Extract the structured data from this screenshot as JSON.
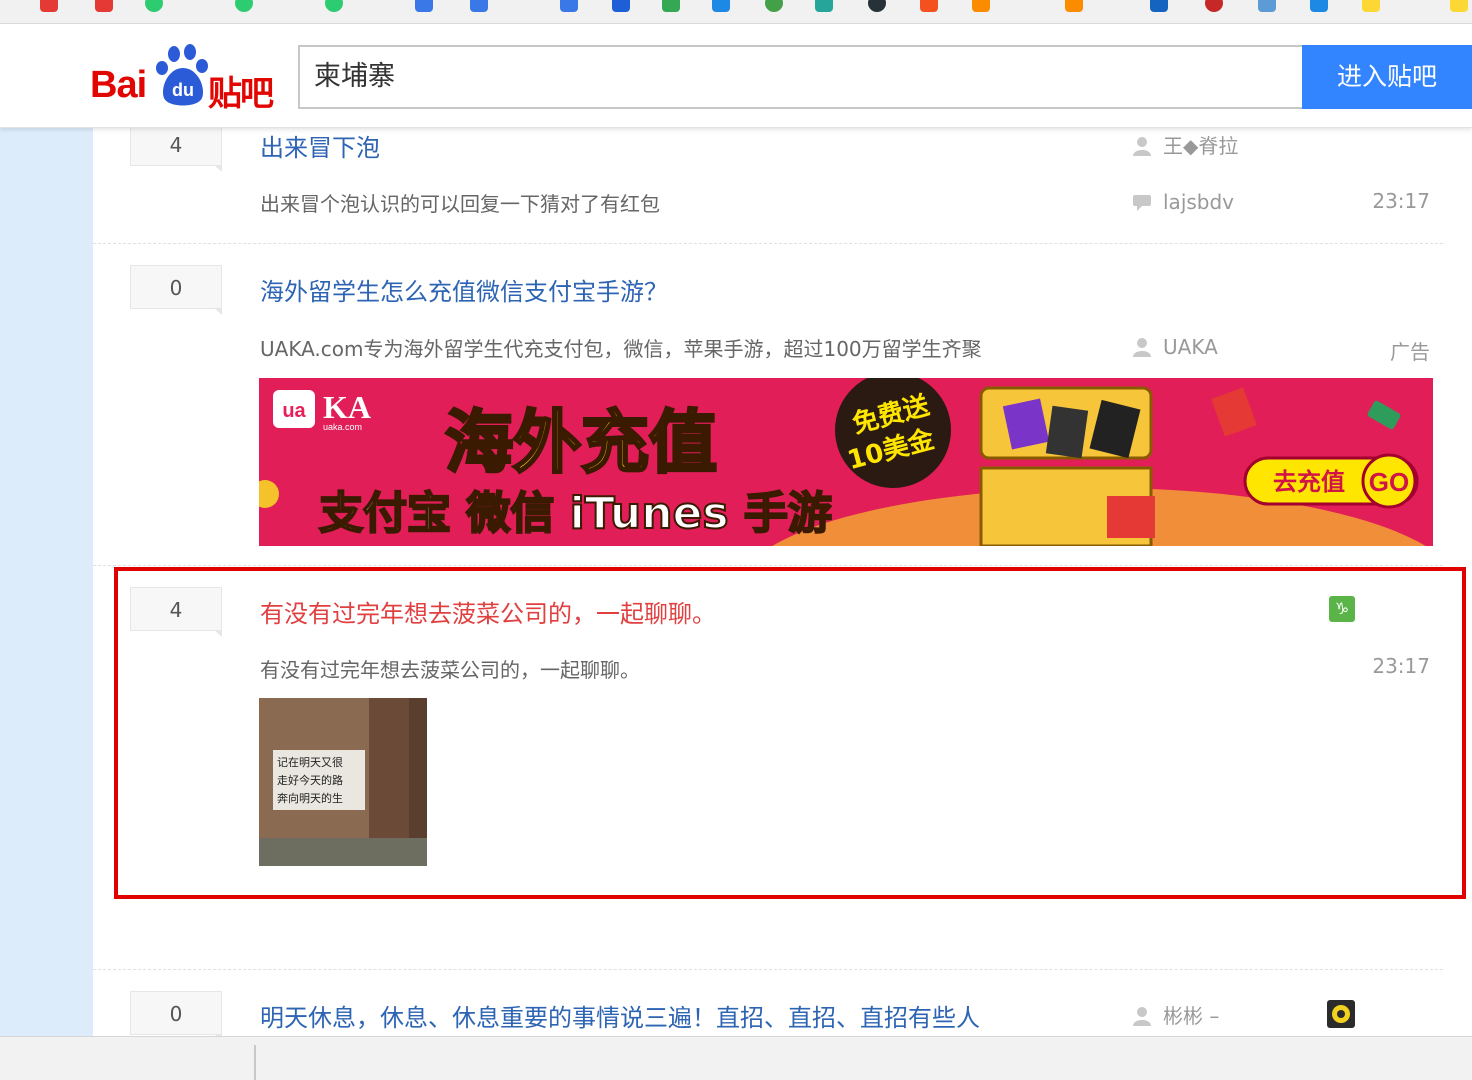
{
  "search": {
    "logo_text_bai": "Bai",
    "logo_text_du": "du",
    "logo_text_tieba": "贴吧",
    "query": "柬埔寨",
    "button_label": "进入贴吧"
  },
  "threads": [
    {
      "reply_count": "4",
      "title": "出来冒下泡",
      "abstract": "出来冒个泡认识的可以回复一下猜对了有红包",
      "author": "王◆脊拉",
      "last_replier": "lajsbdv",
      "time": "23:17"
    },
    {
      "reply_count": "0",
      "title": "海外留学生怎么充值微信支付宝手游？",
      "abstract": "UAKA.com专为海外留学生代充支付包，微信，苹果手游，超过100万留学生齐聚",
      "author": "UAKA",
      "ad_label": "广告",
      "banner": {
        "brand": "KA",
        "brand_small": "ua",
        "brand_sub": "uaka.com",
        "headline": "海外充值",
        "subline": "支付宝 微信 iTunes 手游",
        "promo_line1": "免费送",
        "promo_line2": "10美金",
        "cta": "去充值",
        "go": "GO"
      }
    },
    {
      "reply_count": "4",
      "title": "有没有过完年想去菠菜公司的，一起聊聊。",
      "abstract": "有没有过完年想去菠菜公司的，一起聊聊。",
      "time": "23:17",
      "image_caption": [
        "记在明天又很",
        "走好今天的路",
        "奔向明天的生"
      ]
    },
    {
      "reply_count": "0",
      "title": "明天休息，休息、休息重要的事情说三遍！直招、直招、直招有些人",
      "author": "彬彬 –"
    }
  ],
  "colors": {
    "link_blue": "#2d64b3",
    "highlight_red": "#e00000",
    "title_red": "#e04040",
    "search_blue": "#3385ff",
    "brand_red": "#e10601"
  }
}
